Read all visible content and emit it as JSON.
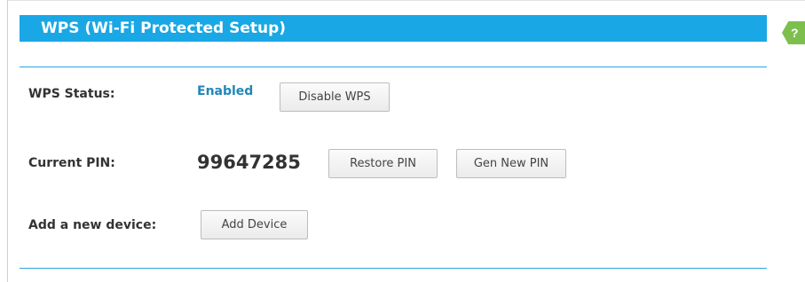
{
  "header": {
    "title": "WPS (Wi-Fi Protected Setup)",
    "help_glyph": "?"
  },
  "rows": {
    "status": {
      "label": "WPS Status:",
      "value": "Enabled",
      "button": "Disable WPS"
    },
    "pin": {
      "label": "Current PIN:",
      "value": "99647285",
      "restore_button": "Restore PIN",
      "gen_button": "Gen New PIN"
    },
    "device": {
      "label": "Add a new device:",
      "button": "Add Device"
    }
  },
  "colors": {
    "title_bar": "#1aa7e5",
    "status_enabled": "#2087b8",
    "divider": "#2ca4dc",
    "help_tab": "#7dbf4d"
  }
}
